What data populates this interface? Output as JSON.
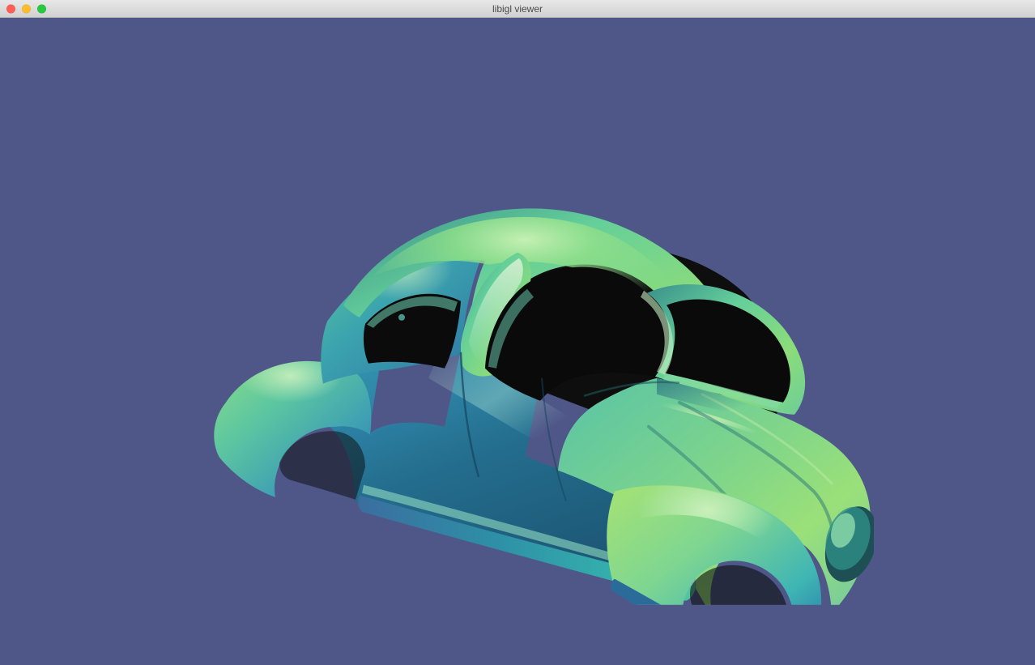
{
  "window": {
    "title": "libigl viewer",
    "titlebar_buttons": {
      "close": "close",
      "minimize": "minimize",
      "maximize": "maximize"
    }
  },
  "viewer": {
    "background_color": "#4f5789",
    "mesh_description": "Car body shell (VW Beetle style) rendered with viridis-like scalar color map",
    "colormap_colors": {
      "low": "#2e6aa8",
      "mid": "#34c1b9",
      "high": "#93e072"
    }
  }
}
